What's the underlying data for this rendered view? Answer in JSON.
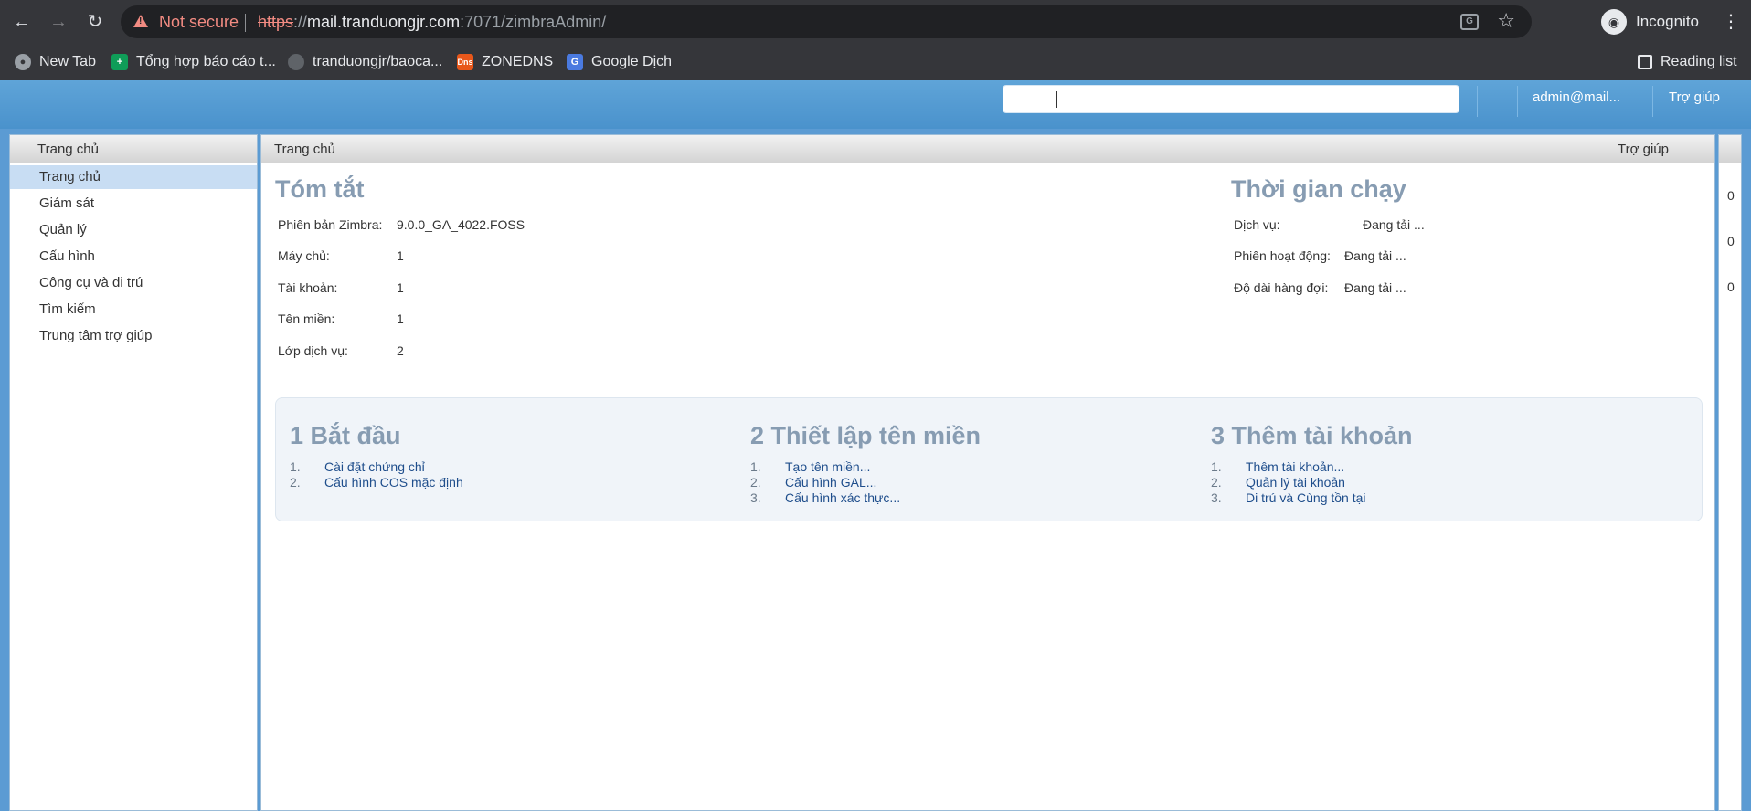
{
  "browser": {
    "security_label": "Not secure",
    "url_scheme": "https",
    "url_sep": "://",
    "url_host": "mail.tranduongjr.com",
    "url_rest": ":7071/zimbraAdmin/",
    "profile_label": "Incognito",
    "bookmarks": [
      {
        "label": "New Tab",
        "icon": "globe-icon"
      },
      {
        "label": "Tổng hợp báo cáo t...",
        "icon": "sheets-icon"
      },
      {
        "label": "tranduongjr/baoca...",
        "icon": "github-icon"
      },
      {
        "label": "ZONEDNS",
        "icon": "dns-icon",
        "icon_text": "Dns"
      },
      {
        "label": "Google Dịch",
        "icon": "google-translate-icon"
      }
    ],
    "reading_list_label": "Reading list"
  },
  "header": {
    "search_value": "",
    "user_label": "admin@mail...",
    "help_label": "Trợ giúp"
  },
  "left_panel": {
    "title": "Trang chủ",
    "items": [
      {
        "label": "Trang chủ",
        "active": true
      },
      {
        "label": "Giám sát"
      },
      {
        "label": "Quản lý"
      },
      {
        "label": "Cấu hình"
      },
      {
        "label": "Công cụ và di trú"
      },
      {
        "label": "Tìm kiếm"
      },
      {
        "label": "Trung tâm trợ giúp"
      }
    ]
  },
  "main": {
    "title": "Trang chủ",
    "help_label": "Trợ giúp",
    "summary": {
      "title": "Tóm tắt",
      "rows": [
        {
          "label": "Phiên bản Zimbra:",
          "value": "9.0.0_GA_4022.FOSS"
        },
        {
          "label": "Máy chủ:",
          "value": "1"
        },
        {
          "label": "Tài khoản:",
          "value": "1"
        },
        {
          "label": "Tên miền:",
          "value": "1"
        },
        {
          "label": "Lớp dịch vụ:",
          "value": "2"
        }
      ]
    },
    "runtime": {
      "title": "Thời gian chạy",
      "rows": [
        {
          "label": "Dịch vụ:",
          "value": "Đang tải ..."
        },
        {
          "label": "Phiên hoạt động:",
          "value": "Đang tải ..."
        },
        {
          "label": "Độ dài hàng đợi:",
          "value": "Đang tải ..."
        }
      ]
    },
    "steps": [
      {
        "title": "1 Bắt đầu",
        "items": [
          {
            "num": "1.",
            "label": "Cài đặt chứng chỉ"
          },
          {
            "num": "2.",
            "label": "Cấu hình COS mặc định"
          }
        ]
      },
      {
        "title": "2 Thiết lập tên miền",
        "items": [
          {
            "num": "1.",
            "label": "Tạo tên miền..."
          },
          {
            "num": "2.",
            "label": "Cấu hình GAL..."
          },
          {
            "num": "3.",
            "label": "Cấu hình xác thực..."
          }
        ]
      },
      {
        "title": "3 Thêm tài khoản",
        "items": [
          {
            "num": "1.",
            "label": "Thêm tài khoản..."
          },
          {
            "num": "2.",
            "label": "Quản lý tài khoản"
          },
          {
            "num": "3.",
            "label": "Di trú và Cùng tồn tại"
          }
        ]
      }
    ]
  },
  "right_strip": {
    "values": [
      "0",
      "0",
      "0"
    ]
  }
}
